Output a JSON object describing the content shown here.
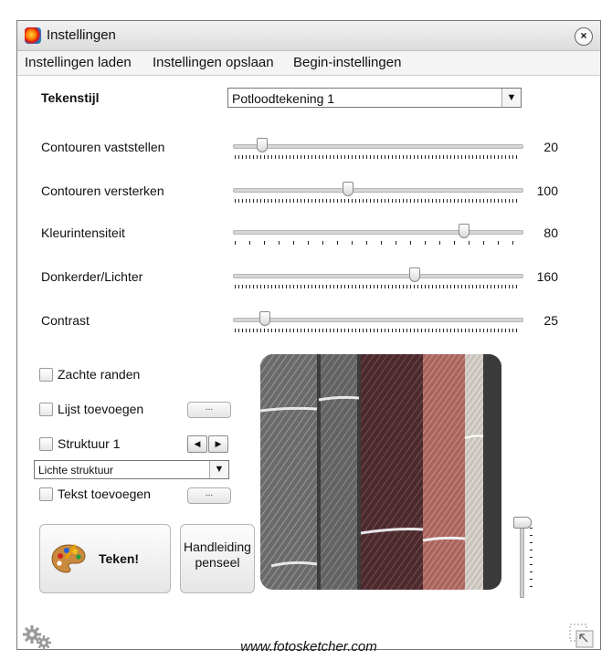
{
  "window": {
    "title": "Instellingen",
    "close": "×"
  },
  "menu": [
    "Instellingen laden",
    "Instellingen opslaan",
    "Begin-instellingen"
  ],
  "style": {
    "label": "Tekenstijl",
    "value": "Potloodtekening 1"
  },
  "sliders": [
    {
      "label": "Contouren vaststellen",
      "value": "20",
      "level": 0.1
    },
    {
      "label": "Contouren versterken",
      "value": "100",
      "level": 0.4
    },
    {
      "label": "Kleurintensiteit",
      "value": "80",
      "level": 0.8
    },
    {
      "label": "Donkerder/Lichter",
      "value": "160",
      "level": 0.63
    },
    {
      "label": "Contrast",
      "value": "25",
      "level": 0.11
    }
  ],
  "options": {
    "soft_edges": "Zachte randen",
    "add_frame": "Lijst toevoegen",
    "structure": "Struktuur 1",
    "structure_type": "Lichte struktuur",
    "add_text": "Tekst toevoegen",
    "dots": "..."
  },
  "buttons": {
    "draw": "Teken!",
    "manual": "Handleiding penseel"
  },
  "footer": {
    "url": "www.fotosketcher.com"
  },
  "colors": {
    "accent_orange": "#ff7a00"
  },
  "icons": [
    "palette-icon",
    "gear-icon",
    "resize-icon",
    "app-icon",
    "close-icon"
  ]
}
